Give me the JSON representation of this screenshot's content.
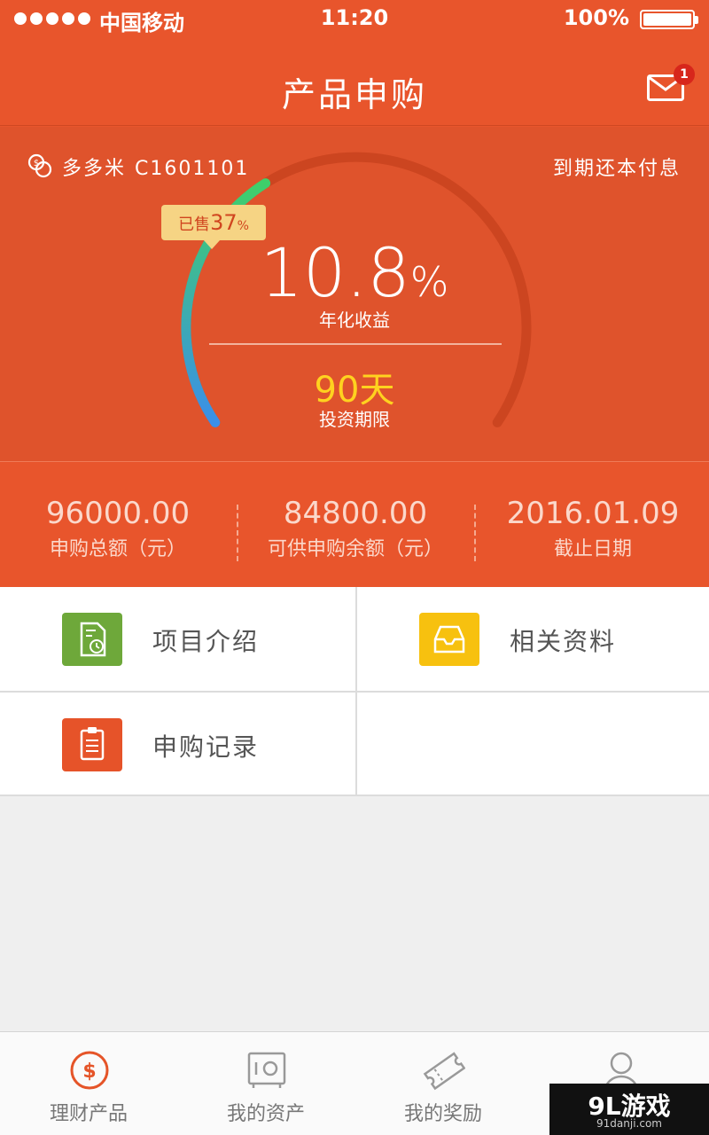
{
  "status_bar": {
    "carrier": "中国移动",
    "time": "11:20",
    "battery": "100%"
  },
  "nav": {
    "title": "产品申购",
    "unread_badge": "1"
  },
  "product": {
    "name": "多多米",
    "code": "C1601101",
    "repayment": "到期还本付息",
    "sold_prefix": "已售",
    "sold_value": "37",
    "sold_unit": "%",
    "sold_fraction": 0.37,
    "rate_value": "10.8",
    "rate_unit": "%",
    "rate_label": "年化收益",
    "term_value": "90天",
    "term_label": "投资期限"
  },
  "stats": [
    {
      "value": "96000.00",
      "label": "申购总额（元）"
    },
    {
      "value": "84800.00",
      "label": "可供申购余额（元）"
    },
    {
      "value": "2016.01.09",
      "label": "截止日期"
    }
  ],
  "menu": [
    {
      "label": "项目介绍",
      "icon": "document-clock-icon",
      "color": "#6ea83a"
    },
    {
      "label": "相关资料",
      "icon": "inbox-tray-icon",
      "color": "#f7c10f"
    },
    {
      "label": "申购记录",
      "icon": "clipboard-icon",
      "color": "#e65329"
    }
  ],
  "tabs": [
    {
      "label": "理财产品",
      "icon": "dollar-circle-icon",
      "active": true
    },
    {
      "label": "我的资产",
      "icon": "safe-icon",
      "active": false
    },
    {
      "label": "我的奖励",
      "icon": "ticket-icon",
      "active": false
    },
    {
      "label": "",
      "icon": "user-icon",
      "active": false
    }
  ],
  "watermark": {
    "main": "9L游戏",
    "sub": "91danji.com"
  },
  "colors": {
    "primary": "#e8552c",
    "hero_bg": "#df532c",
    "term_yellow": "#ffd21f",
    "gauge_start": "#3fcf6a",
    "gauge_end": "#3b8fe8",
    "tab_active": "#e55428"
  }
}
